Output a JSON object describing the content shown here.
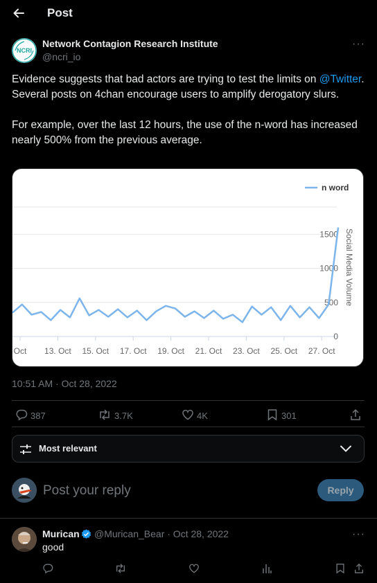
{
  "header": {
    "title": "Post"
  },
  "author": {
    "name": "Network Contagion Research Institute",
    "handle": "@ncri_io",
    "avatar_text": "NCRI"
  },
  "tweet": {
    "text1_pre": "Evidence suggests that bad actors are trying to test the limits on ",
    "mention": "@Twitter",
    "text1_post": ". Several posts on 4chan encourage users to amplify derogatory slurs.",
    "text2": "For example, over the last 12 hours, the use of the n-word has increased nearly 500% from the previous average.",
    "timestamp": "10:51 AM · Oct 28, 2022"
  },
  "stats": {
    "replies": "387",
    "reposts": "3.7K",
    "likes": "4K",
    "bookmarks": "301"
  },
  "sort": {
    "label": "Most relevant"
  },
  "reply_box": {
    "placeholder": "Post your reply",
    "button": "Reply"
  },
  "comment": {
    "name": "Murican",
    "meta": "@Murican_Bear · Oct 28, 2022",
    "text": "good"
  },
  "chart_data": {
    "type": "line",
    "series": [
      {
        "name": "n word",
        "values": [
          350,
          470,
          320,
          360,
          240,
          390,
          280,
          560,
          310,
          390,
          290,
          400,
          280,
          380,
          240,
          370,
          450,
          410,
          290,
          370,
          270,
          380,
          260,
          320,
          210,
          440,
          320,
          430,
          240,
          450,
          280,
          430,
          270,
          470,
          1600
        ]
      }
    ],
    "x_tick_labels": [
      "Oct",
      "13. Oct",
      "15. Oct",
      "17. Oct",
      "19. Oct",
      "21. Oct",
      "23. Oct",
      "25. Oct",
      "27. Oct"
    ],
    "y_tick_labels": [
      "0",
      "500",
      "1000",
      "1500"
    ],
    "ylim": [
      0,
      1900
    ],
    "ylabel": "Social Media Volume",
    "legend_position": "top-right",
    "grid": true,
    "line_color": "#7cb5ec"
  }
}
